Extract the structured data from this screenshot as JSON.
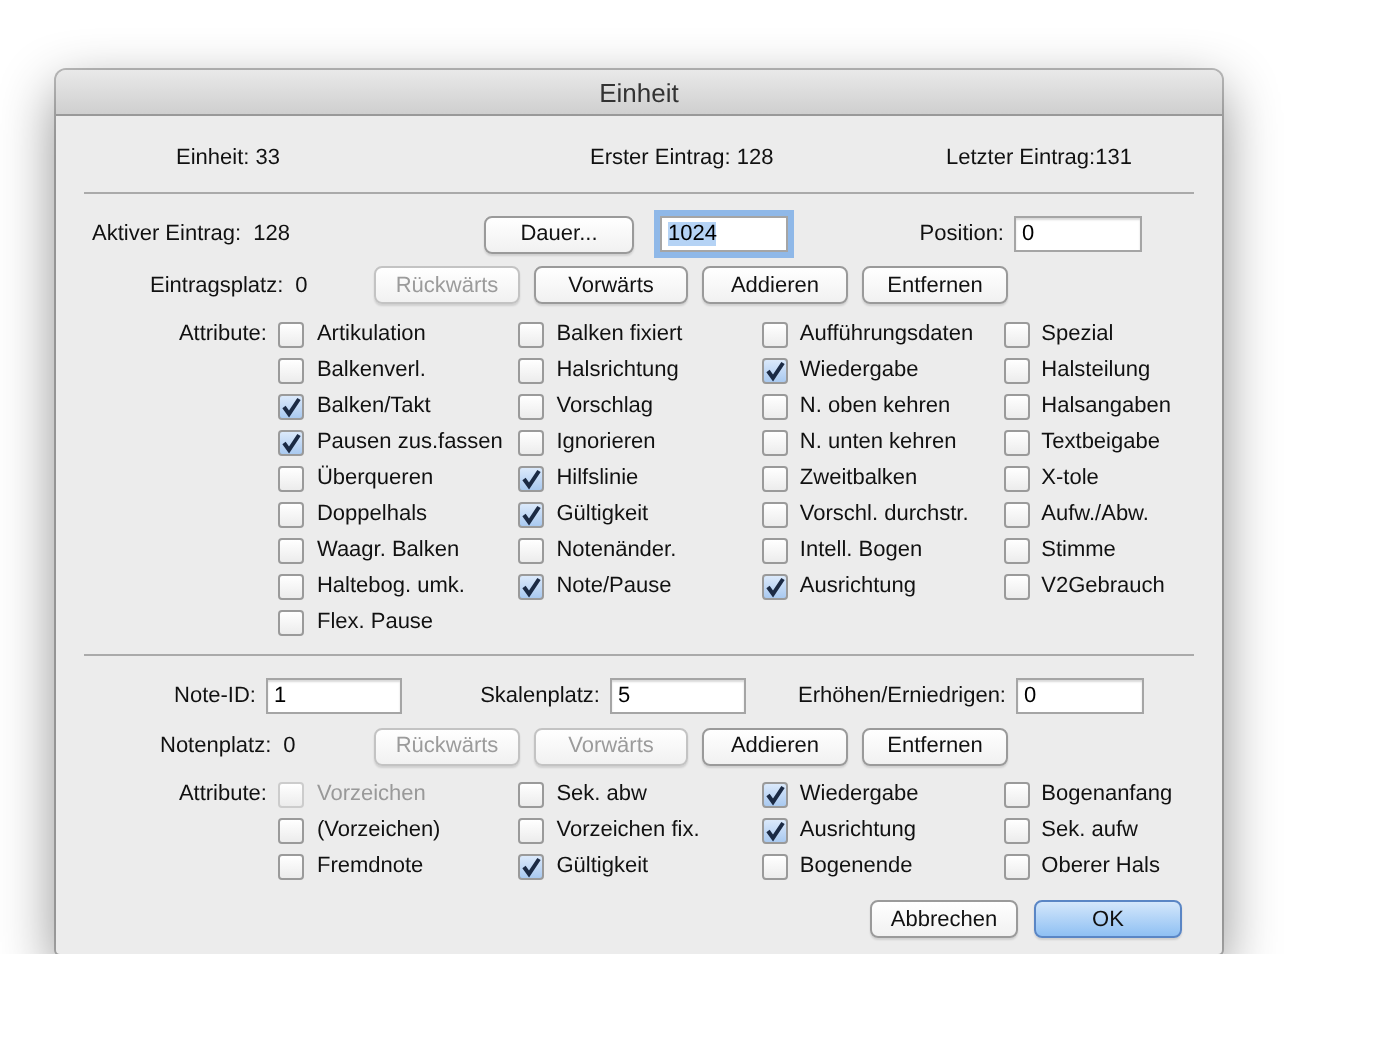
{
  "window": {
    "title": "Einheit"
  },
  "summary": [
    "Einheit: 33",
    "Erster Eintrag: 128",
    "Letzter Eintrag:131"
  ],
  "entry": {
    "active_label": "Aktiver Eintrag:",
    "active_value": "128",
    "duration_button": {
      "label": "Dauer...",
      "disabled": false
    },
    "duration_field": {
      "value": "1024",
      "focused": true
    },
    "position_label": "Position:",
    "position_field": {
      "value": "0",
      "focused": false
    },
    "place_label": "Eintragsplatz:",
    "place_value": "0",
    "buttons": [
      {
        "label": "Rückwärts",
        "disabled": true
      },
      {
        "label": "Vorwärts",
        "disabled": false
      },
      {
        "label": "Addieren",
        "disabled": false
      },
      {
        "label": "Entfernen",
        "disabled": false
      }
    ],
    "attributes_label": "Attribute:",
    "attribute_columns": [
      [
        {
          "label": "Artikulation",
          "checked": false,
          "disabled": false
        },
        {
          "label": "Balkenverl.",
          "checked": false,
          "disabled": false
        },
        {
          "label": "Balken/Takt",
          "checked": true,
          "disabled": false
        },
        {
          "label": "Pausen zus.fassen",
          "checked": true,
          "disabled": false
        },
        {
          "label": "Überqueren",
          "checked": false,
          "disabled": false
        },
        {
          "label": "Doppelhals",
          "checked": false,
          "disabled": false
        },
        {
          "label": "Waagr. Balken",
          "checked": false,
          "disabled": false
        },
        {
          "label": "Haltebog. umk.",
          "checked": false,
          "disabled": false
        },
        {
          "label": "Flex. Pause",
          "checked": false,
          "disabled": false
        }
      ],
      [
        {
          "label": "Balken fixiert",
          "checked": false,
          "disabled": false
        },
        {
          "label": "Halsrichtung",
          "checked": false,
          "disabled": false
        },
        {
          "label": "Vorschlag",
          "checked": false,
          "disabled": false
        },
        {
          "label": "Ignorieren",
          "checked": false,
          "disabled": false
        },
        {
          "label": "Hilfslinie",
          "checked": true,
          "disabled": false
        },
        {
          "label": "Gültigkeit",
          "checked": true,
          "disabled": false
        },
        {
          "label": "Notenänder.",
          "checked": false,
          "disabled": false
        },
        {
          "label": "Note/Pause",
          "checked": true,
          "disabled": false
        }
      ],
      [
        {
          "label": "Aufführungsdaten",
          "checked": false,
          "disabled": false
        },
        {
          "label": "Wiedergabe",
          "checked": true,
          "disabled": false
        },
        {
          "label": "N. oben kehren",
          "checked": false,
          "disabled": false
        },
        {
          "label": "N. unten kehren",
          "checked": false,
          "disabled": false
        },
        {
          "label": "Zweitbalken",
          "checked": false,
          "disabled": false
        },
        {
          "label": "Vorschl. durchstr.",
          "checked": false,
          "disabled": false
        },
        {
          "label": "Intell. Bogen",
          "checked": false,
          "disabled": false
        },
        {
          "label": "Ausrichtung",
          "checked": true,
          "disabled": false
        }
      ],
      [
        {
          "label": "Spezial",
          "checked": false,
          "disabled": false
        },
        {
          "label": "Halsteilung",
          "checked": false,
          "disabled": false
        },
        {
          "label": "Halsangaben",
          "checked": false,
          "disabled": false
        },
        {
          "label": "Textbeigabe",
          "checked": false,
          "disabled": false
        },
        {
          "label": "X-tole",
          "checked": false,
          "disabled": false
        },
        {
          "label": "Aufw./Abw.",
          "checked": false,
          "disabled": false
        },
        {
          "label": "Stimme",
          "checked": false,
          "disabled": false
        },
        {
          "label": "V2Gebrauch",
          "checked": false,
          "disabled": false
        }
      ]
    ]
  },
  "note": {
    "fields": [
      {
        "label": "Note-ID:",
        "value": "1"
      },
      {
        "label": "Skalenplatz:",
        "value": "5"
      },
      {
        "label": "Erhöhen/Erniedrigen:",
        "value": "0"
      }
    ],
    "place_label": "Notenplatz:",
    "place_value": "0",
    "buttons": [
      {
        "label": "Rückwärts",
        "disabled": true
      },
      {
        "label": "Vorwärts",
        "disabled": true
      },
      {
        "label": "Addieren",
        "disabled": false
      },
      {
        "label": "Entfernen",
        "disabled": false
      }
    ],
    "attributes_label": "Attribute:",
    "attribute_columns": [
      [
        {
          "label": "Vorzeichen",
          "checked": false,
          "disabled": true
        },
        {
          "label": "(Vorzeichen)",
          "checked": false,
          "disabled": false
        },
        {
          "label": "Fremdnote",
          "checked": false,
          "disabled": false
        }
      ],
      [
        {
          "label": "Sek. abw",
          "checked": false,
          "disabled": false
        },
        {
          "label": "Vorzeichen fix.",
          "checked": false,
          "disabled": false
        },
        {
          "label": "Gültigkeit",
          "checked": true,
          "disabled": false
        }
      ],
      [
        {
          "label": "Wiedergabe",
          "checked": true,
          "disabled": false
        },
        {
          "label": "Ausrichtung",
          "checked": true,
          "disabled": false
        },
        {
          "label": "Bogenende",
          "checked": false,
          "disabled": false
        }
      ],
      [
        {
          "label": "Bogenanfang",
          "checked": false,
          "disabled": false
        },
        {
          "label": "Sek. aufw",
          "checked": false,
          "disabled": false
        },
        {
          "label": "Oberer Hals",
          "checked": false,
          "disabled": false
        }
      ]
    ]
  },
  "footer_buttons": [
    {
      "label": "Abbrechen",
      "kind": "normal"
    },
    {
      "label": "OK",
      "kind": "default"
    }
  ]
}
